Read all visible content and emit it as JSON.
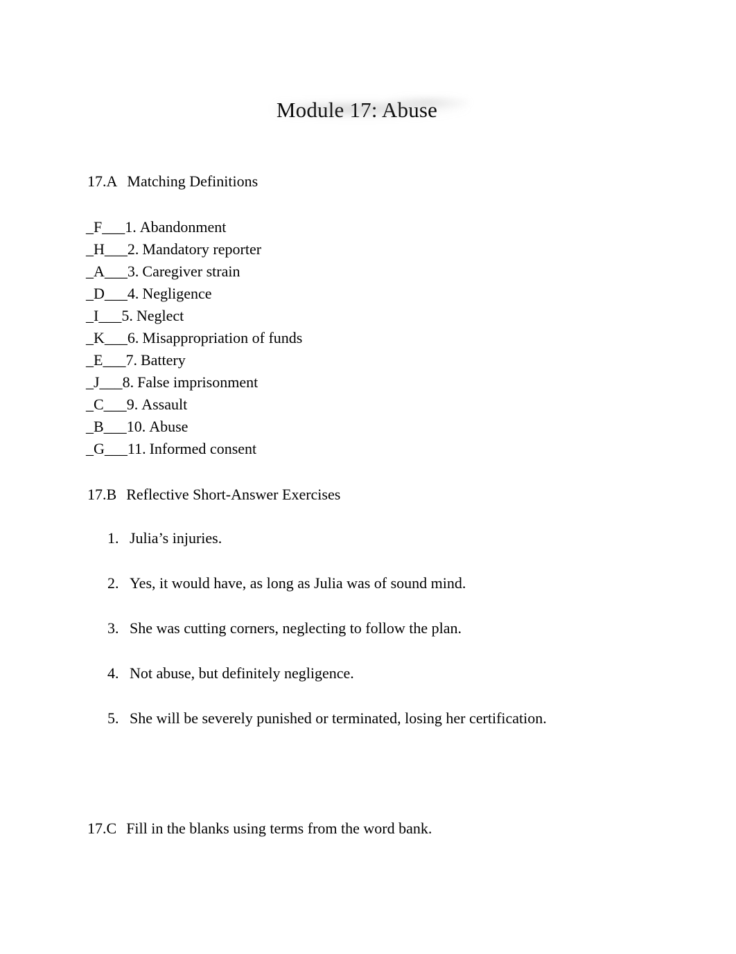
{
  "document": {
    "title": "Module 17: Abuse"
  },
  "sections": {
    "a": {
      "number": "17.A",
      "label": "Matching Definitions",
      "items": [
        {
          "blank": "_F___",
          "number": "1.",
          "term": "Abandonment"
        },
        {
          "blank": "_H___",
          "number": "2.",
          "term": "Mandatory reporter"
        },
        {
          "blank": "_A___",
          "number": "3.",
          "term": "Caregiver strain"
        },
        {
          "blank": "_D___",
          "number": "4.",
          "term": "Negligence"
        },
        {
          "blank": "_I___",
          "number": "5.",
          "term": "Neglect"
        },
        {
          "blank": "_K___",
          "number": "6.",
          "term": "Misappropriation of funds"
        },
        {
          "blank": "_E___",
          "number": "7.",
          "term": "Battery"
        },
        {
          "blank": "_J___",
          "number": "8.",
          "term": "False imprisonment"
        },
        {
          "blank": "_C___",
          "number": "9.",
          "term": "Assault"
        },
        {
          "blank": "_B___",
          "number": "10.",
          "term": "Abuse"
        },
        {
          "blank": "_G___",
          "number": "11.",
          "term": "Informed consent"
        }
      ]
    },
    "b": {
      "number": "17.B",
      "label": "Reflective Short-Answer Exercises",
      "answers": [
        {
          "number": "1.",
          "text": "Julia’s injuries."
        },
        {
          "number": "2.",
          "text": "Yes, it would have, as long as Julia was of sound mind."
        },
        {
          "number": "3.",
          "text": "She was cutting corners, neglecting to follow the plan."
        },
        {
          "number": "4.",
          "text": "Not abuse, but definitely negligence."
        },
        {
          "number": "5.",
          "text": "She will be severely punished or terminated, losing her certification."
        }
      ]
    },
    "c": {
      "number": "17.C",
      "label": "Fill in the blanks using terms from the word bank."
    }
  },
  "colors": {
    "page_background": "#ffffff",
    "text": "#000000",
    "title_smudge": "#808080"
  }
}
